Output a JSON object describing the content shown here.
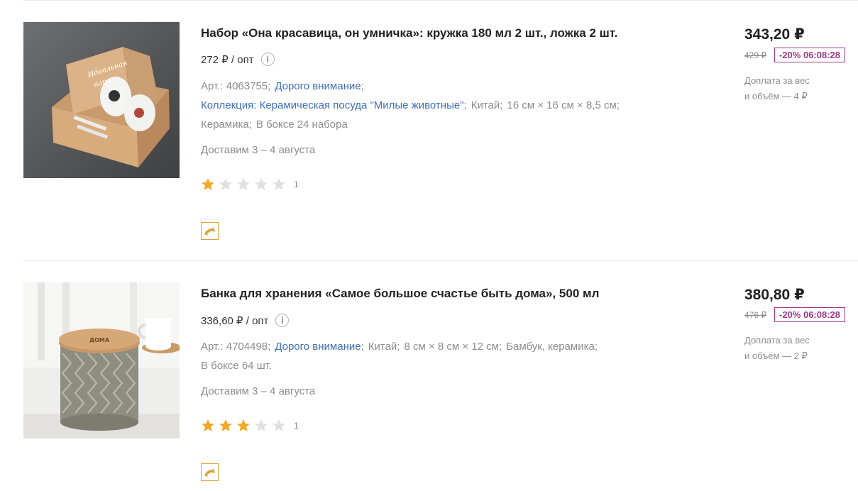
{
  "colors": {
    "link": "#3d6fb6",
    "discount": "#a0378a",
    "star_active": "#f5a623",
    "star_inactive": "#e0e0e0",
    "badge_border": "#d9a33a"
  },
  "products": [
    {
      "title": "Набор «Она красавица, он умничка»: кружка 180 мл 2 шт., ложка 2 шт.",
      "opt_price": "272 ₽ / опт",
      "info_icon": "info-icon",
      "article_label": "Арт.: 4063755;",
      "brand_link": "Дорого внимание",
      "brand_sep": ";",
      "collection_link": "Коллекция: Керамическая посуда \"Милые животные\"",
      "collection_sep": ";",
      "country": "Китай;",
      "size": "16 см × 16 см × 8,5 см;",
      "material": "Керамика;",
      "packing": "В боксе 24 набора",
      "delivery": "Доставим 3 – 4 августа",
      "rating": 1,
      "rating_max": 5,
      "rating_count": "1",
      "price": "343,20 ₽",
      "old_price": "429 ₽",
      "discount": "-20% 06:08:28",
      "surcharge_line1": "Доплата за вес",
      "surcharge_line2": "и объём — 4 ₽",
      "badge_icon": "dolphin-icon"
    },
    {
      "title": "Банка для хранения «Самое большое счастье быть дома», 500 мл",
      "opt_price": "336,60 ₽ / опт",
      "info_icon": "info-icon",
      "article_label": "Арт.: 4704498;",
      "brand_link": "Дорого внимание",
      "brand_sep": ";",
      "country": "Китай;",
      "size": "8 см × 8 см × 12 см;",
      "material": "Бамбук, керамика;",
      "packing": "В боксе 64 шт.",
      "delivery": "Доставим 3 – 4 августа",
      "rating": 3,
      "rating_max": 5,
      "rating_count": "1",
      "price": "380,80 ₽",
      "old_price": "476 ₽",
      "discount": "-20% 06:08:28",
      "surcharge_line1": "Доплата за вес",
      "surcharge_line2": "и объём — 2 ₽",
      "badge_icon": "dolphin-icon"
    }
  ]
}
